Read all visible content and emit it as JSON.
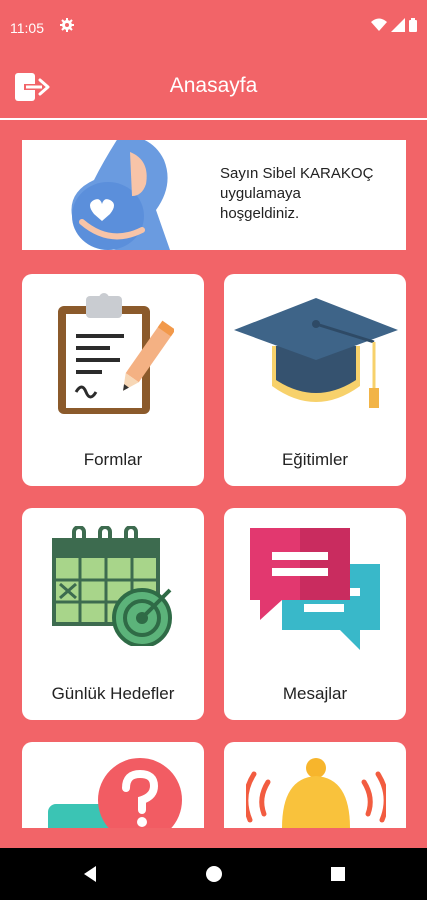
{
  "status_bar": {
    "time": "11:05"
  },
  "app_bar": {
    "title": "Anasayfa"
  },
  "welcome": {
    "line1": "Sayın Sibel KARAKOÇ",
    "line2": "uygulamaya",
    "line3": "hoşgeldiniz."
  },
  "tiles": [
    {
      "label": "Formlar"
    },
    {
      "label": "Eğitimler"
    },
    {
      "label": "Günlük Hedefler"
    },
    {
      "label": "Mesajlar"
    }
  ],
  "colors": {
    "background": "#f26468",
    "card": "#ffffff"
  }
}
